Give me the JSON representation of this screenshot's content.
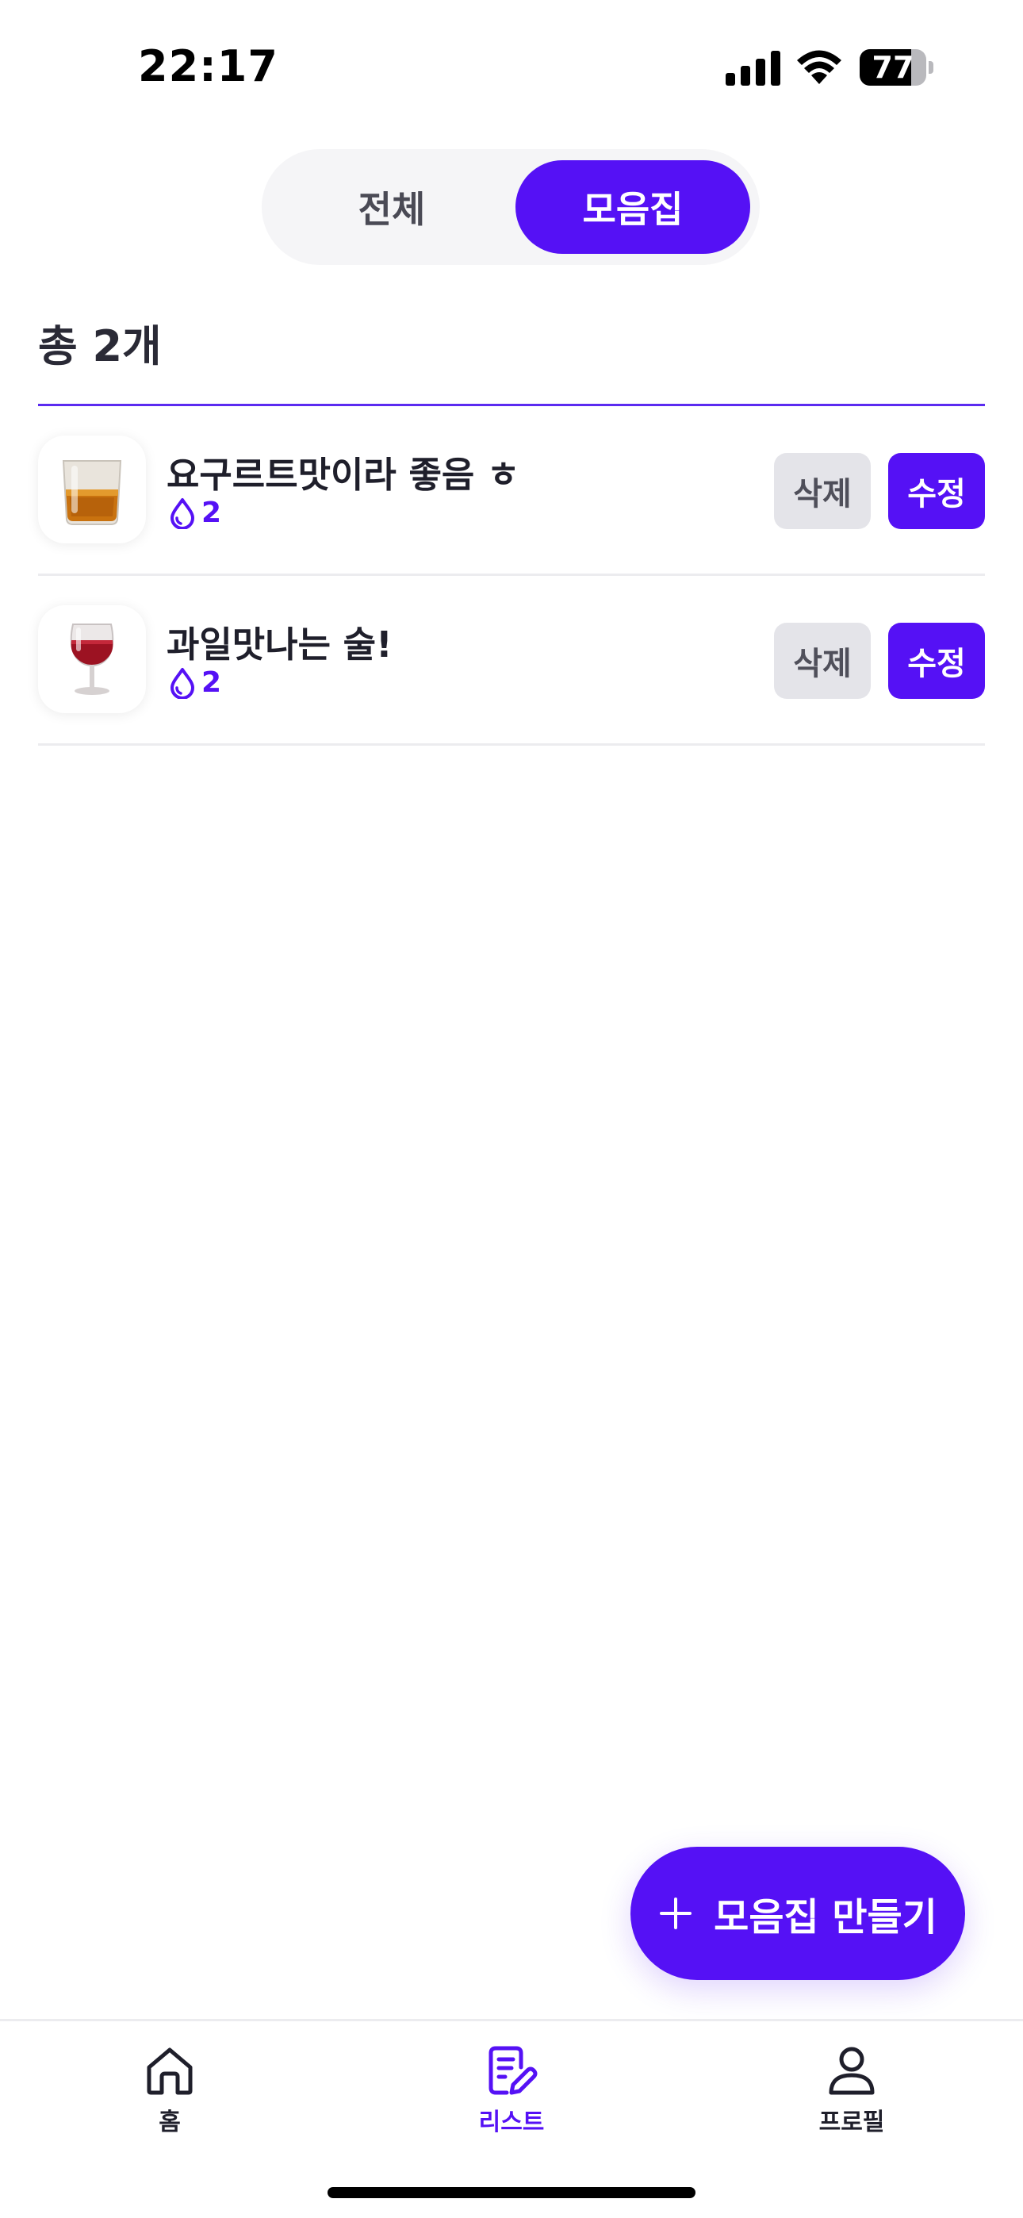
{
  "status_bar": {
    "time": "22:17",
    "battery": "77",
    "battery_level": 0.77,
    "icons": [
      "signal-icon",
      "wifi-icon",
      "battery-icon"
    ]
  },
  "segmented": {
    "tabs": [
      {
        "label": "전체",
        "selected": false
      },
      {
        "label": "모음집",
        "selected": true
      }
    ]
  },
  "summary": {
    "total_label": "총 2개"
  },
  "collections": [
    {
      "title": "요구르트맛이라 좋음 ㅎ",
      "count": "2",
      "icon": "whiskey-glass-icon",
      "delete_label": "삭제",
      "edit_label": "수정"
    },
    {
      "title": "과일맛나는 술!",
      "count": "2",
      "icon": "wine-glass-icon",
      "delete_label": "삭제",
      "edit_label": "수정"
    }
  ],
  "fab": {
    "label": "모음집 만들기",
    "icon": "plus-icon"
  },
  "tab_bar": {
    "items": [
      {
        "label": "홈",
        "icon": "home-icon",
        "active": false
      },
      {
        "label": "리스트",
        "icon": "list-edit-icon",
        "active": true
      },
      {
        "label": "프로필",
        "icon": "user-icon",
        "active": false
      }
    ]
  },
  "colors": {
    "accent": "#5511f5",
    "secondary_button": "#e4e4e9",
    "segment_background": "#f5f5f7"
  }
}
